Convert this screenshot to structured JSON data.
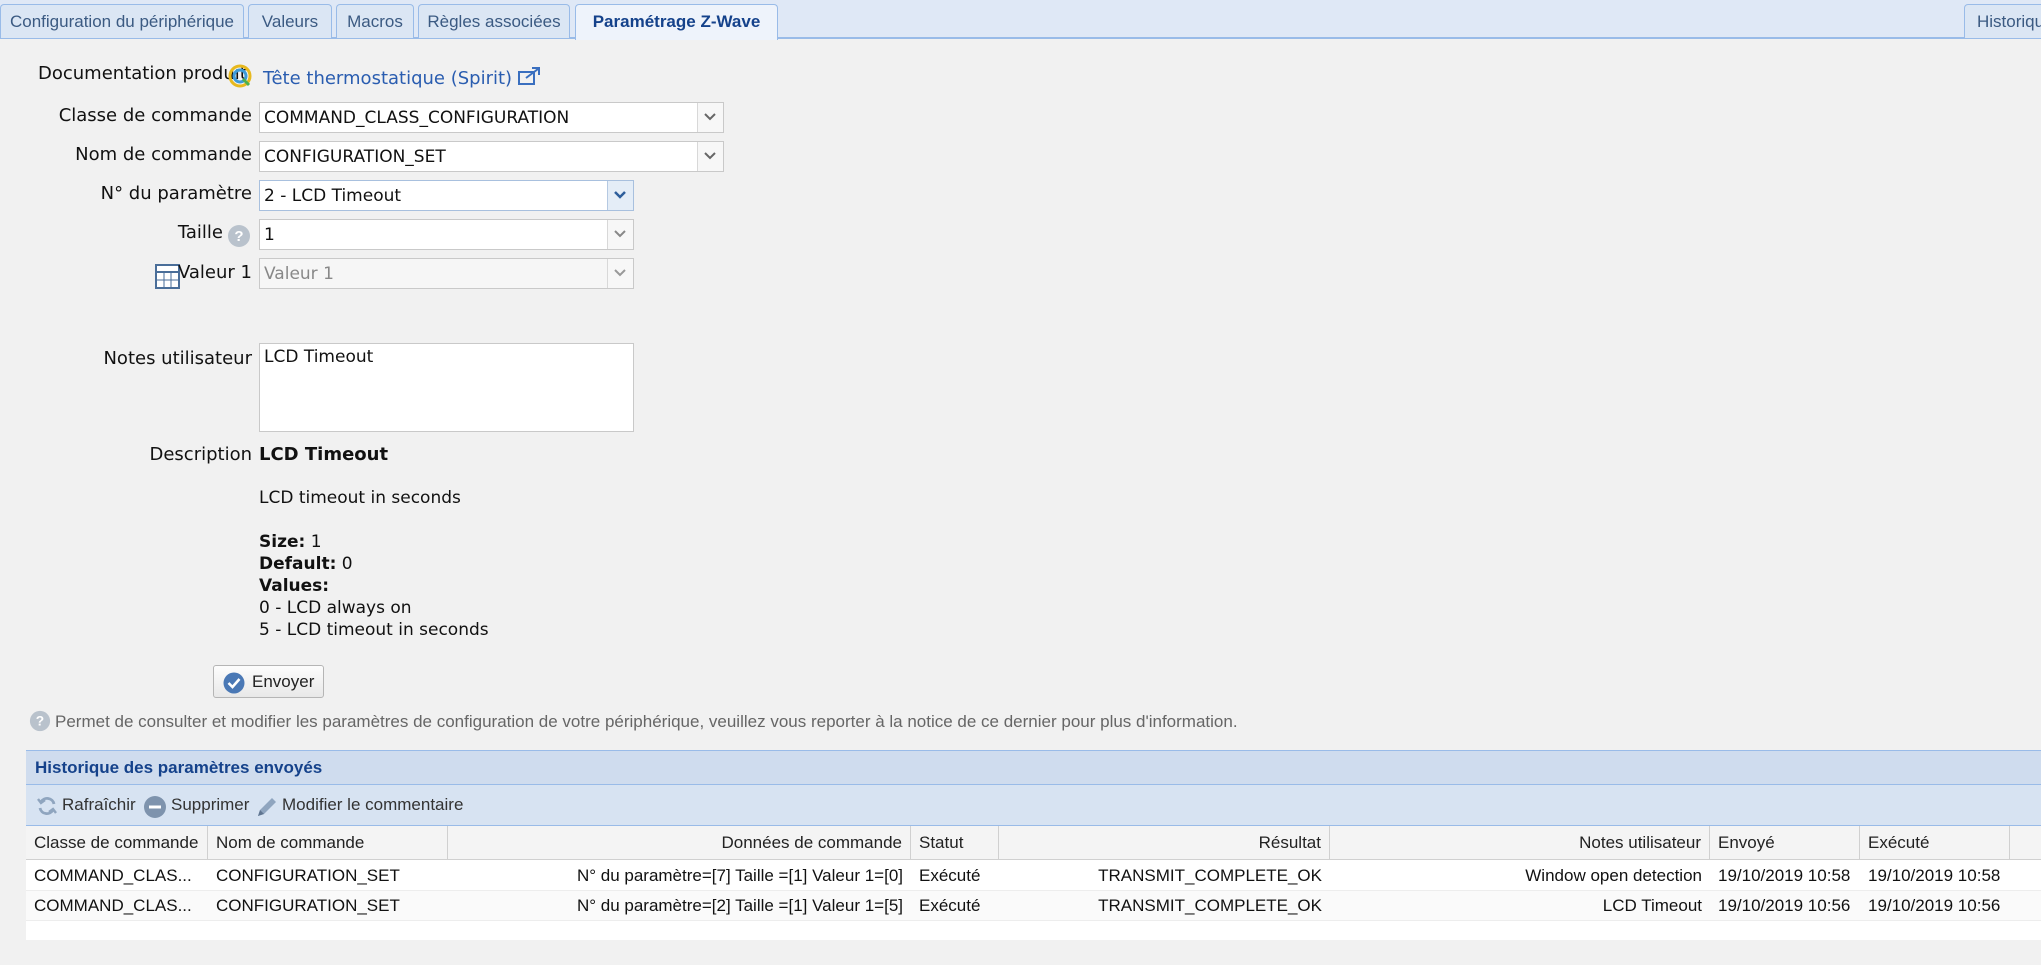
{
  "tabs": [
    {
      "label": "Configuration du périphérique"
    },
    {
      "label": "Valeurs"
    },
    {
      "label": "Macros"
    },
    {
      "label": "Règles associées"
    },
    {
      "label": "Paramétrage Z-Wave"
    },
    {
      "label": "Historique"
    }
  ],
  "form": {
    "doc_label": "Documentation produit",
    "doc_link": "Tête thermostatique (Spirit)",
    "command_class_label": "Classe de commande",
    "command_class_value": "COMMAND_CLASS_CONFIGURATION",
    "command_name_label": "Nom de commande",
    "command_name_value": "CONFIGURATION_SET",
    "param_label": "N° du paramètre",
    "param_value": "2 - LCD Timeout",
    "size_label": "Taille",
    "size_value": "1",
    "value1_label": "Valeur 1",
    "value1_placeholder": "Valeur 1",
    "notes_label": "Notes utilisateur",
    "notes_value": "LCD Timeout",
    "description_label": "Description",
    "send_label": "Envoyer"
  },
  "description": {
    "title": "LCD Timeout",
    "summary": "LCD timeout in seconds",
    "size_key": "Size:",
    "size_value": "1",
    "default_key": "Default:",
    "default_value": "0",
    "values_key": "Values:",
    "values": [
      "0 - LCD always on",
      "5 - LCD timeout in seconds"
    ]
  },
  "help_text": "Permet de consulter et modifier les paramètres de configuration de votre périphérique, veuillez vous reporter à la notice de ce dernier pour plus d'information.",
  "history": {
    "title": "Historique des paramètres envoyés",
    "toolbar": {
      "refresh": "Rafraîchir",
      "delete": "Supprimer",
      "edit_comment": "Modifier le commentaire"
    },
    "columns": [
      "Classe de commande",
      "Nom de commande",
      "Données de commande",
      "Statut",
      "Résultat",
      "Notes utilisateur",
      "Envoyé",
      "Exécuté"
    ],
    "rows": [
      {
        "class": "COMMAND_CLAS...",
        "name": "CONFIGURATION_SET",
        "data": "N° du paramètre=[7] Taille =[1] Valeur 1=[0]",
        "status": "Exécuté",
        "result": "TRANSMIT_COMPLETE_OK",
        "notes": "Window open detection",
        "sent": "19/10/2019 10:58",
        "executed": "19/10/2019 10:58"
      },
      {
        "class": "COMMAND_CLAS...",
        "name": "CONFIGURATION_SET",
        "data": "N° du paramètre=[2] Taille =[1] Valeur 1=[5]",
        "status": "Exécuté",
        "result": "TRANSMIT_COMPLETE_OK",
        "notes": "LCD Timeout",
        "sent": "19/10/2019 10:56",
        "executed": "19/10/2019 10:56"
      }
    ]
  },
  "colors": {
    "accent": "#15428b",
    "tab_border": "#99bbe8",
    "ok_icon": "#4a78b5"
  }
}
